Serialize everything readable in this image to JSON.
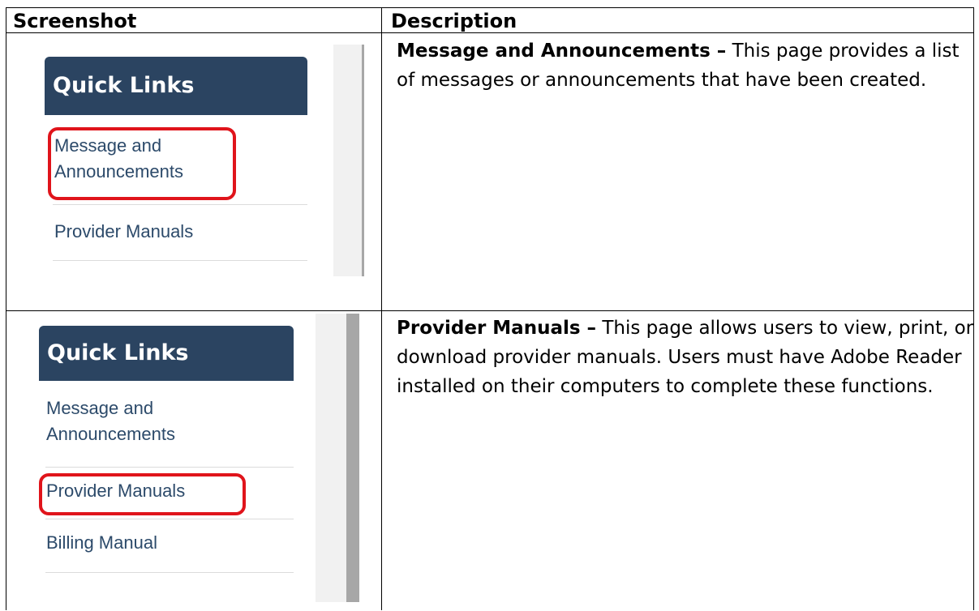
{
  "table": {
    "col_headers": [
      "Screenshot",
      "Description"
    ],
    "rows": [
      {
        "widget": {
          "title": "Quick Links",
          "items": [
            "Message and Announcements",
            "Provider Manuals"
          ],
          "highlighted": "Message and Announcements"
        },
        "desc_title": "Message and Announcements –",
        "desc_text": " This page provides a list of messages or announcements that have been created."
      },
      {
        "widget": {
          "title": "Quick Links",
          "items": [
            "Message and Announcements",
            "Provider Manuals",
            "Billing Manual"
          ],
          "highlighted": "Provider Manuals"
        },
        "desc_title": "Provider Manuals –",
        "desc_text": " This page allows users to view, print, or download provider manuals. Users must have Adobe Reader installed on their computers to complete these functions."
      }
    ]
  },
  "colors": {
    "header_bg": "#2b4461",
    "link": "#2c4a6a",
    "highlight": "#e0141b"
  }
}
